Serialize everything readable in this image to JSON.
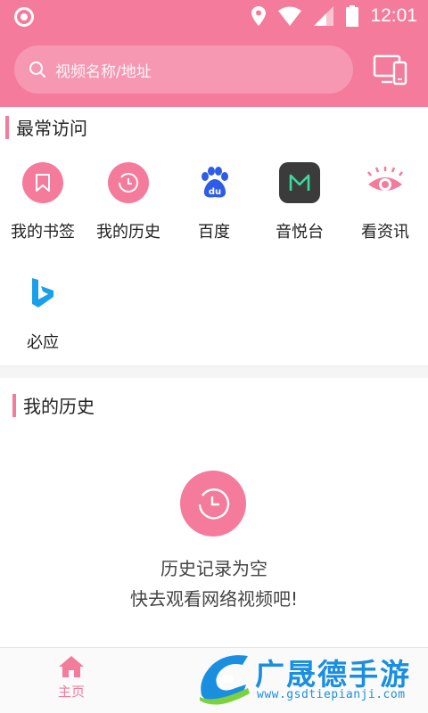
{
  "status_bar": {
    "time": "12:01"
  },
  "search": {
    "placeholder": "视频名称/地址"
  },
  "frequent": {
    "title": "最常访问",
    "items": [
      {
        "label": "我的书签",
        "icon": "bookmark-icon"
      },
      {
        "label": "我的历史",
        "icon": "history-clock-icon"
      },
      {
        "label": "百度",
        "icon": "baidu-paw-icon"
      },
      {
        "label": "音悦台",
        "icon": "yinyuetai-m-icon"
      },
      {
        "label": "看资讯",
        "icon": "eye-icon"
      },
      {
        "label": "必应",
        "icon": "bing-icon"
      }
    ]
  },
  "history": {
    "title": "我的历史",
    "empty_line1": "历史记录为空",
    "empty_line2": "快去观看网络视频吧!"
  },
  "bottom_nav": {
    "home_label": "主页"
  },
  "watermark": {
    "title": "广晟德手游",
    "url": "www.gsdtiepianji.com"
  },
  "colors": {
    "accent": "#f47b9b",
    "watermark_blue": "#1a8fe0"
  }
}
